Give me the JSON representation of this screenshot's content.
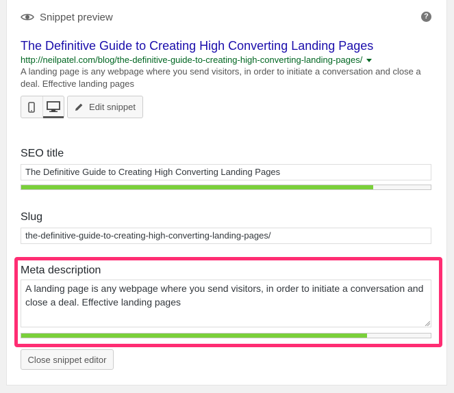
{
  "header": {
    "title": "Snippet preview",
    "help_icon": "?"
  },
  "snippet": {
    "title": "The Definitive Guide to Creating High Converting Landing Pages",
    "url": "http://neilpatel.com/blog/the-definitive-guide-to-creating-high-converting-landing-pages/",
    "description": "A landing page is any webpage where you send visitors, in order to initiate a conversation and close a deal. Effective landing pages"
  },
  "toolbar": {
    "mobile_icon": "mobile-icon",
    "desktop_icon": "desktop-icon",
    "active_mode": "desktop",
    "edit_label": "Edit snippet"
  },
  "seo_title": {
    "label": "SEO title",
    "value": "The Definitive Guide to Creating High Converting Landing Pages",
    "progress": 0.86
  },
  "slug": {
    "label": "Slug",
    "value": "the-definitive-guide-to-creating-high-converting-landing-pages/"
  },
  "meta_description": {
    "label": "Meta description",
    "value": "A landing page is any webpage where you send visitors, in order to initiate a conversation and close a deal. Effective landing pages",
    "progress": 0.845
  },
  "close_label": "Close snippet editor",
  "colors": {
    "link": "#1a0dab",
    "url": "#006621",
    "progress_good": "#7ad03a",
    "highlight": "#ff2d73"
  }
}
